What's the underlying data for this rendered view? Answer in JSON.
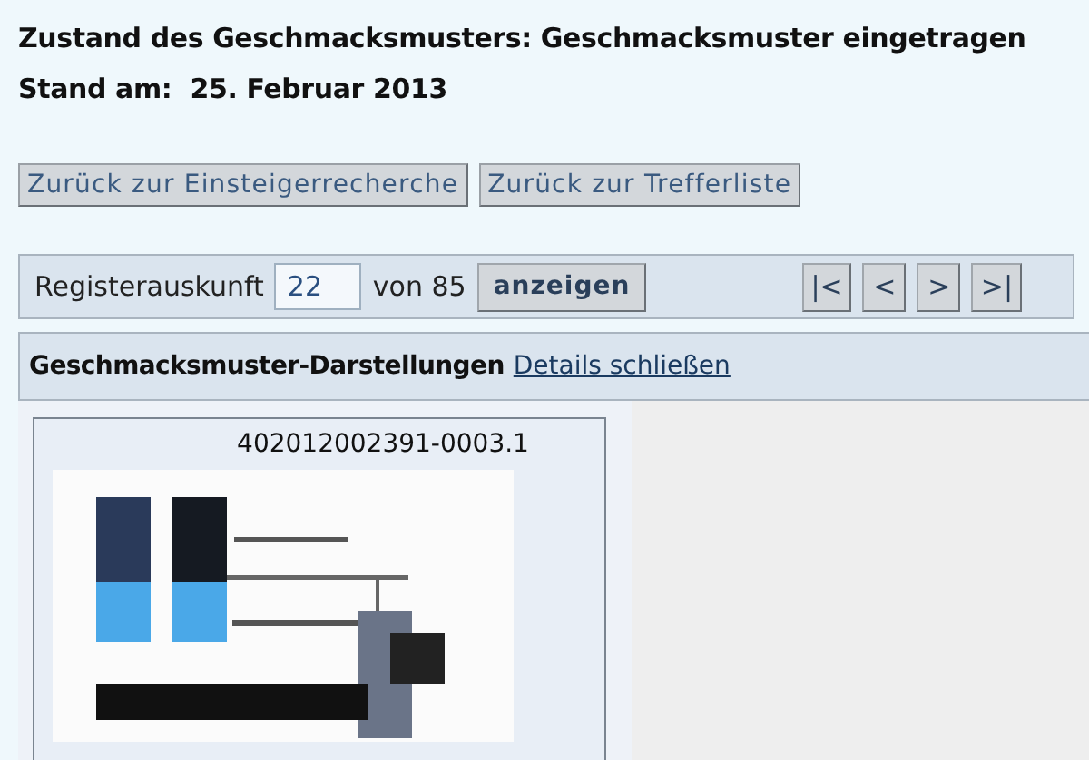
{
  "status_line": {
    "label": "Zustand des Geschmacksmusters:",
    "value": "Geschmacksmuster eingetragen"
  },
  "date_line": {
    "label": "Stand am:",
    "value": "25. Februar 2013"
  },
  "back_buttons": [
    "Zurück zur Einsteigerrecherche",
    "Zurück zur Trefferliste"
  ],
  "navigation": {
    "label": "Registerauskunft",
    "value": "22",
    "total": "von 85",
    "show_button": "anzeigen",
    "paging_buttons": [
      "|<",
      "<",
      ">",
      ">|"
    ]
  },
  "section": {
    "title": "Geschmacksmuster-Darstellungen",
    "link": "Details schließen"
  },
  "design_card": {
    "number": "402012002391-0003.1"
  }
}
